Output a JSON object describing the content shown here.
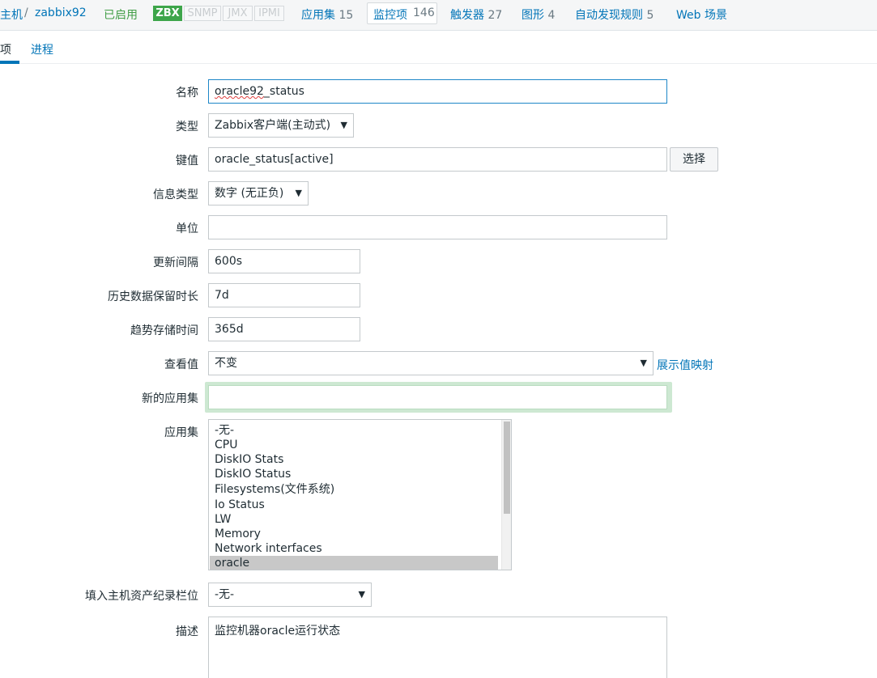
{
  "nav": {
    "hosts_link": "主机",
    "separator": "/",
    "host_name": "zabbix92",
    "status": "已启用",
    "protocols": [
      "ZBX",
      "SNMP",
      "JMX",
      "IPMI"
    ],
    "applications": {
      "label": "应用集",
      "count": "15"
    },
    "items": {
      "label": "监控项",
      "count": "146"
    },
    "triggers": {
      "label": "触发器",
      "count": "27"
    },
    "graphs": {
      "label": "图形",
      "count": "4"
    },
    "discovery": {
      "label": "自动发现规则",
      "count": "5"
    },
    "web": {
      "label": "Web 场景"
    }
  },
  "subtabs": {
    "item": "项",
    "process": "进程"
  },
  "form": {
    "name_label": "名称",
    "name_value_misspelled": "oracle92",
    "name_value_rest": "_status",
    "type_label": "类型",
    "type_value": "Zabbix客户端(主动式)",
    "key_label": "键值",
    "key_value": "oracle_status[active]",
    "key_select_button": "选择",
    "info_type_label": "信息类型",
    "info_type_value": "数字 (无正负)",
    "units_label": "单位",
    "units_value": "",
    "interval_label": "更新间隔",
    "interval_value": "600s",
    "history_label": "历史数据保留时长",
    "history_value": "7d",
    "trends_label": "趋势存储时间",
    "trends_value": "365d",
    "valuemap_label": "查看值",
    "valuemap_value": "不变",
    "valuemap_link": "展示值映射",
    "new_app_label": "新的应用集",
    "new_app_value": "",
    "apps_label": "应用集",
    "apps_options": [
      "-无-",
      "CPU",
      "DiskIO Stats",
      "DiskIO Status",
      "Filesystems(文件系统)",
      "Io Status",
      "LW",
      "Memory",
      "Network interfaces",
      "oracle"
    ],
    "apps_selected": "oracle",
    "inventory_label": "填入主机资产纪录栏位",
    "inventory_value": "-无-",
    "desc_label": "描述",
    "desc_value": "监控机器oracle运行状态"
  },
  "colors": {
    "link": "#0275b8",
    "enabled_green": "#429e47",
    "zbx_badge": "#3da54a",
    "focus_glow": "#cde8d2"
  }
}
